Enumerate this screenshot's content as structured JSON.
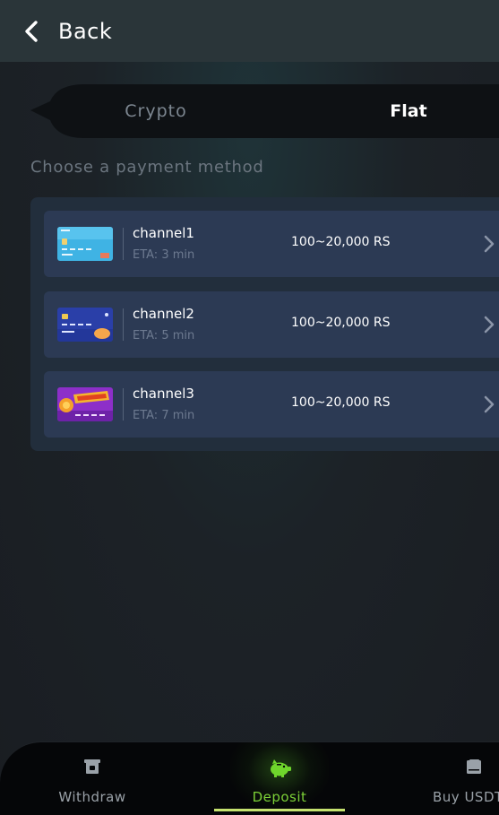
{
  "header": {
    "back_label": "Back",
    "back_icon": "chevron-left-icon"
  },
  "tabs": [
    {
      "label": "Crypto",
      "active": false
    },
    {
      "label": "Flat",
      "active": true
    }
  ],
  "section_title": "Choose a payment method",
  "channels": [
    {
      "name": "channel1",
      "eta": "ETA: 3 min",
      "range": "100~20,000 RS",
      "thumb": "light-blue-card-image"
    },
    {
      "name": "channel2",
      "eta": "ETA: 5 min",
      "range": "100~20,000 RS",
      "thumb": "dark-blue-card-image"
    },
    {
      "name": "channel3",
      "eta": "ETA: 7 min",
      "range": "100~20,000 RS",
      "thumb": "top-up-bonus-card-image"
    }
  ],
  "bottom_nav": [
    {
      "label": "Withdraw",
      "icon": "atm-icon",
      "active": false
    },
    {
      "label": "Deposit",
      "icon": "piggy-bank-icon",
      "active": true
    },
    {
      "label": "Buy USDT",
      "icon": "wallet-icon",
      "active": false
    }
  ],
  "colors": {
    "accent_green": "#7cd137",
    "indicator": "#c6e26f",
    "card_bg": "#2c3a54",
    "panel_bg": "#222e3c",
    "header_bg": "#2a3539"
  }
}
